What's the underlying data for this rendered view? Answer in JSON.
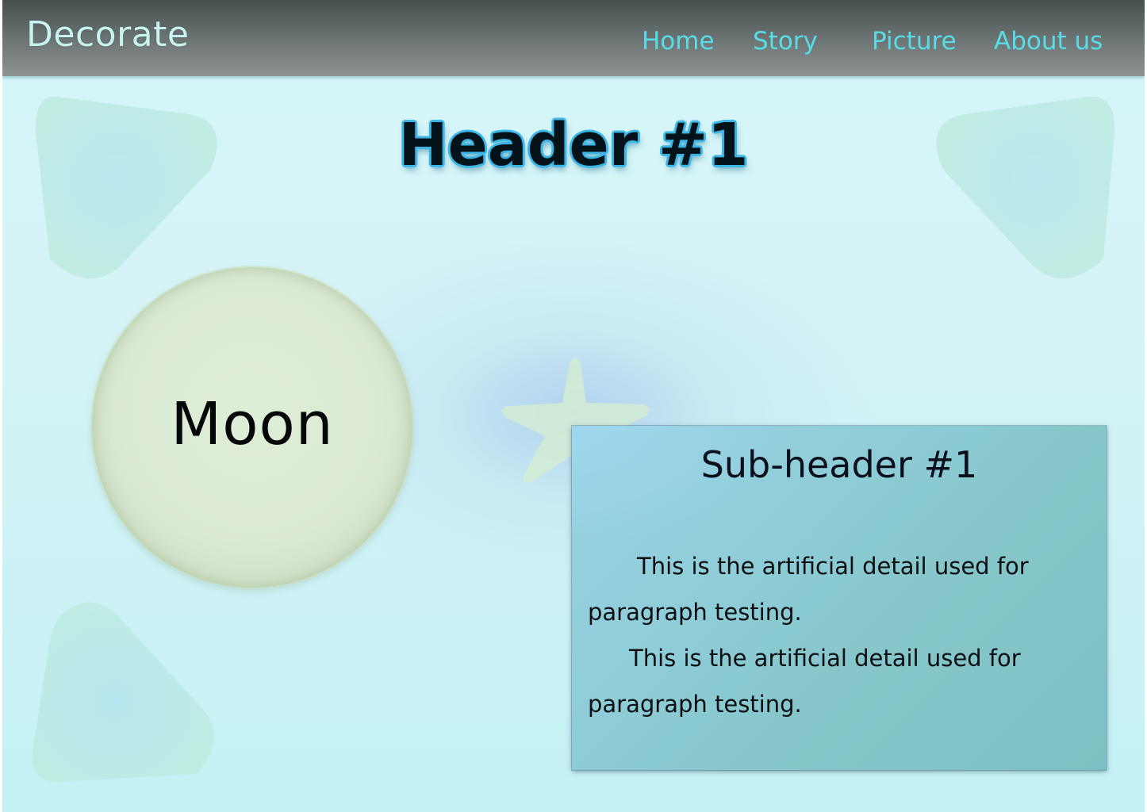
{
  "navbar": {
    "brand": "Decorate",
    "links": [
      "Home",
      "Story",
      "Picture",
      "About us"
    ]
  },
  "main": {
    "header": "Header #1",
    "moon_label": "Moon"
  },
  "card": {
    "subheader": "Sub-header #1",
    "paragraphs": [
      "This is the artificial detail used for paragraph testing.",
      "This is the artificial detail used for paragraph testing."
    ]
  },
  "colors": {
    "navbar": "#5e6565",
    "nav_link": "#58dce8",
    "background": "#d4f6f8",
    "moon": "#dbe9d2",
    "card": "#8ac9cf",
    "header_outline": "#3cb6e6"
  }
}
